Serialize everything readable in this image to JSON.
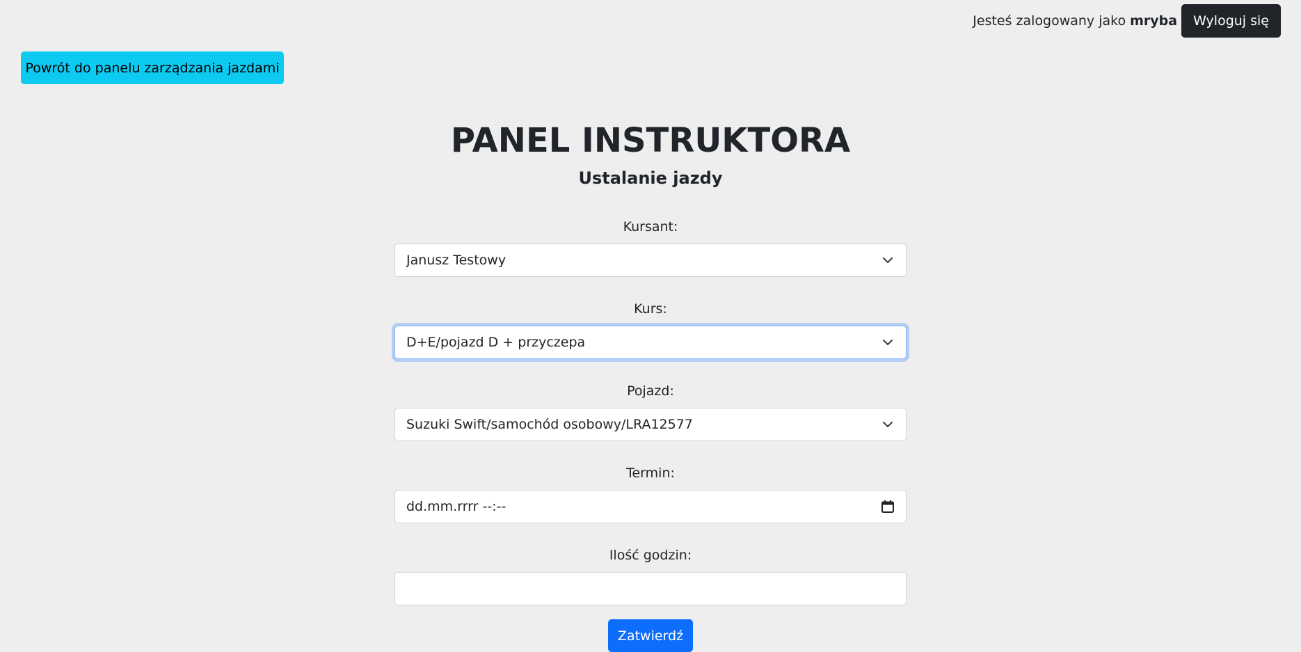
{
  "header": {
    "logged_prefix": "Jesteś zalogowany jako",
    "username": "mryba",
    "logout_label": "Wyloguj się"
  },
  "nav": {
    "back_label": "Powrót do panelu zarządzania jazdami"
  },
  "page": {
    "title": "PANEL INSTRUKTORA",
    "subtitle": "Ustalanie jazdy"
  },
  "form": {
    "student": {
      "label": "Kursant:",
      "value": "Janusz Testowy"
    },
    "course": {
      "label": "Kurs:",
      "value": "D+E/pojazd D + przyczepa"
    },
    "vehicle": {
      "label": "Pojazd:",
      "value": "Suzuki Swift/samochód osobowy/LRA12577"
    },
    "date": {
      "label": "Termin:",
      "placeholder": "dd.mm.rrrr --:--"
    },
    "hours": {
      "label": "Ilość godzin:",
      "value": ""
    },
    "submit_label": "Zatwierdź"
  },
  "colors": {
    "background": "#eeeeee",
    "back_button": "#0dcaf0",
    "logout_button": "#212529",
    "submit_button": "#0d6efd",
    "focus_ring": "#86b7fe"
  },
  "icons": {
    "select": "chevron-down-icon",
    "date": "calendar-icon"
  }
}
